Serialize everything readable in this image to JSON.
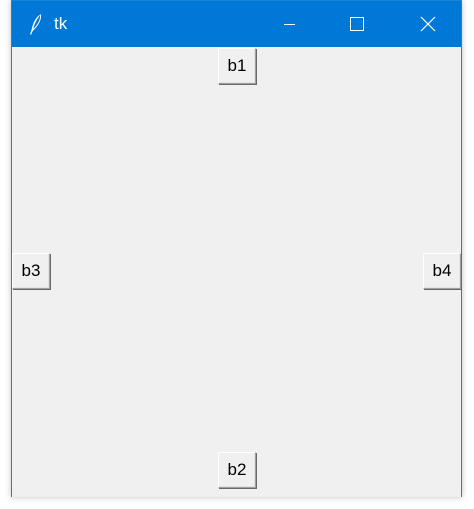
{
  "window": {
    "title": "tk",
    "title_bar_color": "#0078d7",
    "background_color": "#f0f0f0",
    "app_icon": "feather-icon",
    "controls": {
      "minimize_icon": "minimize-icon",
      "maximize_icon": "maximize-icon",
      "close_icon": "close-icon"
    }
  },
  "buttons": {
    "b1": "b1",
    "b2": "b2",
    "b3": "b3",
    "b4": "b4"
  }
}
